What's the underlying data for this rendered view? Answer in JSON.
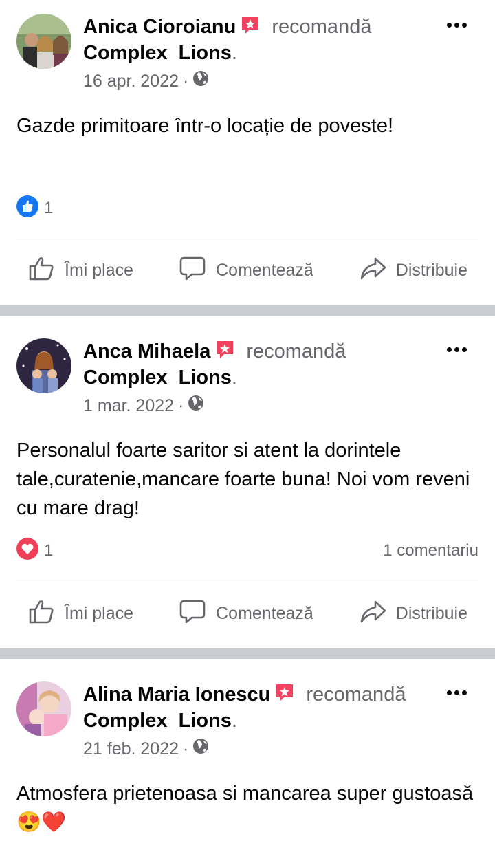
{
  "posts": [
    {
      "author": "Anica Cioroianu",
      "verb": "recomandă",
      "page": "Complex  Lions",
      "page_suffix": ".",
      "date": "16 apr. 2022",
      "date_sep": "·",
      "text": "Gazde primitoare într-o locație de poveste!",
      "reaction_type": "like",
      "reaction_count": "1",
      "comments": "",
      "avatar_colors": [
        "#6b8e4e",
        "#c9a46a",
        "#8a6d52"
      ]
    },
    {
      "author": "Anca Mihaela",
      "verb": "recomandă",
      "page": "Complex  Lions",
      "page_suffix": ".",
      "date": "1 mar. 2022",
      "date_sep": "·",
      "text": "Personalul foarte saritor si atent la dorintele tale,curatenie,mancare foarte buna! Noi vom reveni cu mare drag!",
      "reaction_type": "love",
      "reaction_count": "1",
      "comments": "1 comentariu",
      "avatar_colors": [
        "#3a2f4a",
        "#d28a5a",
        "#4a6a9a"
      ]
    },
    {
      "author": "Alina Maria Ionescu",
      "verb": "recomandă",
      "page": "Complex  Lions",
      "page_suffix": ".",
      "date": "21 feb. 2022",
      "date_sep": "·",
      "text": "Atmosfera prietenoasa si mancarea super gustoasă 😍❤️",
      "reaction_type": "",
      "reaction_count": "",
      "comments": "",
      "avatar_colors": [
        "#e8c2d6",
        "#b46aa0",
        "#f0d8c8"
      ]
    }
  ],
  "actions": {
    "like": "Îmi place",
    "comment": "Comentează",
    "share": "Distribuie"
  },
  "colors": {
    "like_blue": "#1877f2",
    "love_red": "#f33e58",
    "recommend_red": "#f3425f",
    "secondary_text": "#65676b",
    "separator": "#c9ccd1"
  }
}
